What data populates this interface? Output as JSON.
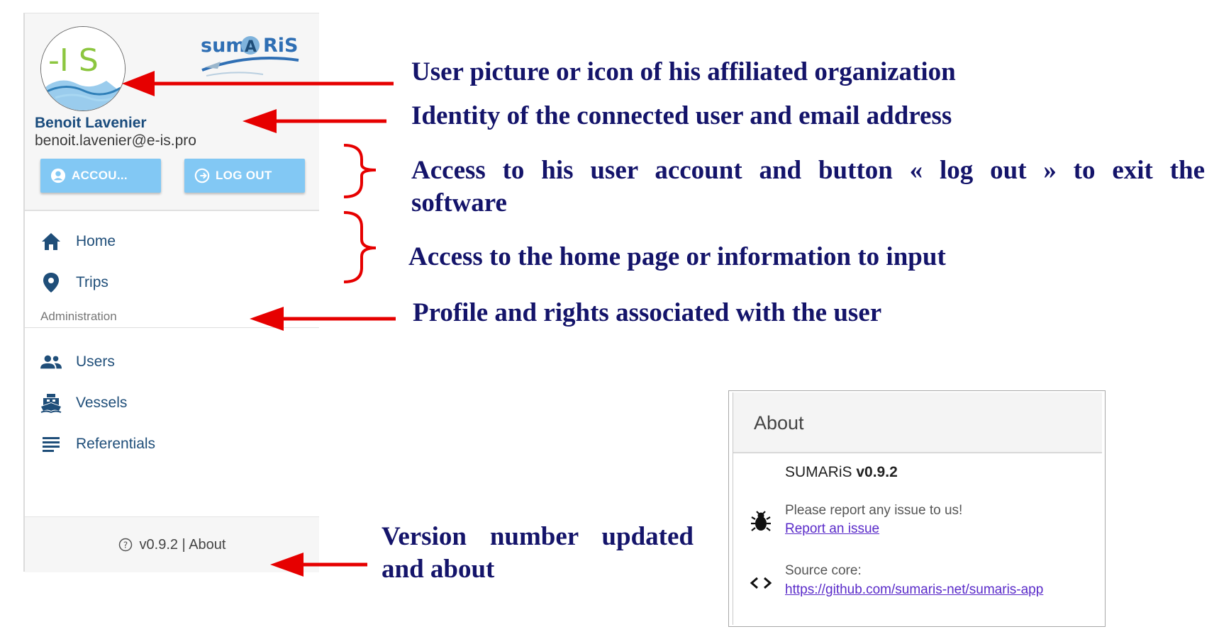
{
  "menu": {
    "user_name": "Benoit Lavenier",
    "user_email": "benoit.lavenier@e-is.pro",
    "avatar_text": "-I S",
    "logo_text_1": "sum",
    "logo_text_2": "A",
    "logo_text_3": "RiS",
    "account_label": "ACCOU...",
    "logout_label": "LOG OUT",
    "items_main": [
      {
        "label": "Home",
        "icon": "home-icon"
      },
      {
        "label": "Trips",
        "icon": "location-pin-icon"
      }
    ],
    "section_label": "Administration",
    "items_admin": [
      {
        "label": "Users",
        "icon": "people-icon"
      },
      {
        "label": "Vessels",
        "icon": "boat-icon"
      },
      {
        "label": "Referentials",
        "icon": "list-icon"
      }
    ],
    "footer_label": "v0.9.2 | About"
  },
  "annotations": {
    "avatar_note": "User picture or icon of his affiliated organization",
    "identity_note": "Identity of the connected user and email address",
    "buttons_note_line1": "Access to his user account and button « log out » to exit the",
    "buttons_note_line2": "software",
    "nav_note": "Access to the home page or information to input",
    "profile_note": "Profile and rights associated with the user",
    "version_note_line1": "Version number updated",
    "version_note_line2": "and about"
  },
  "about": {
    "title": "About",
    "app_name": "SUMARiS",
    "app_version": "v0.9.2",
    "report_text": "Please report any issue to us!",
    "report_link": "Report an issue",
    "source_text": "Source core:",
    "source_link": "https://github.com/sumaris-net/sumaris-app"
  },
  "colors": {
    "annotation_text": "#14146a",
    "arrow": "#e60000",
    "button": "#82c8f4",
    "menu_text": "#1f4e79"
  }
}
